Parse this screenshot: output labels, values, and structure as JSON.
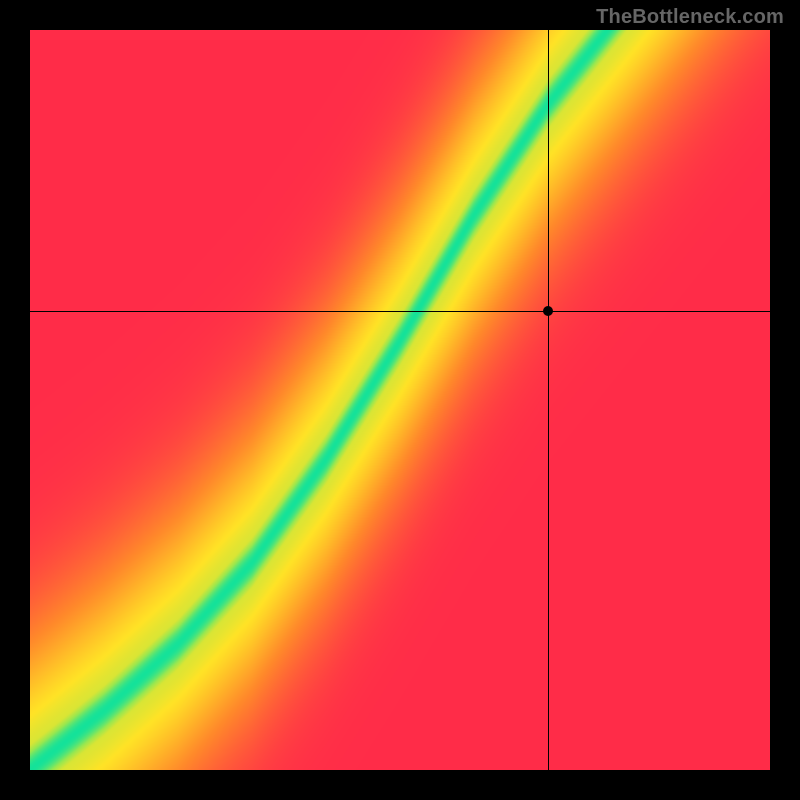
{
  "watermark": "TheBottleneck.com",
  "chart_data": {
    "type": "heatmap",
    "title": "",
    "xlabel": "",
    "ylabel": "",
    "xlim": [
      0,
      1
    ],
    "ylim": [
      0,
      1
    ],
    "grid": false,
    "legend": false,
    "colormap": {
      "description": "diverging red→yellow→green heatmap; green = optimal balance ridge",
      "stops": [
        {
          "t": 0.0,
          "hex": "#ff2c48"
        },
        {
          "t": 0.35,
          "hex": "#ff8a2a"
        },
        {
          "t": 0.65,
          "hex": "#ffe326"
        },
        {
          "t": 0.85,
          "hex": "#9ae84f"
        },
        {
          "t": 1.0,
          "hex": "#14e29a"
        }
      ]
    },
    "ridge": {
      "description": "approximate centerline of green optimal band (x,y in [0,1], origin bottom-left)",
      "points": [
        [
          0.0,
          0.0
        ],
        [
          0.1,
          0.08
        ],
        [
          0.2,
          0.17
        ],
        [
          0.3,
          0.28
        ],
        [
          0.4,
          0.42
        ],
        [
          0.5,
          0.58
        ],
        [
          0.6,
          0.75
        ],
        [
          0.7,
          0.9
        ],
        [
          0.78,
          1.0
        ]
      ],
      "band_halfwidth_y": 0.05
    },
    "crosshair": {
      "x": 0.7,
      "y": 0.62
    },
    "marker": {
      "x": 0.7,
      "y": 0.62
    }
  }
}
